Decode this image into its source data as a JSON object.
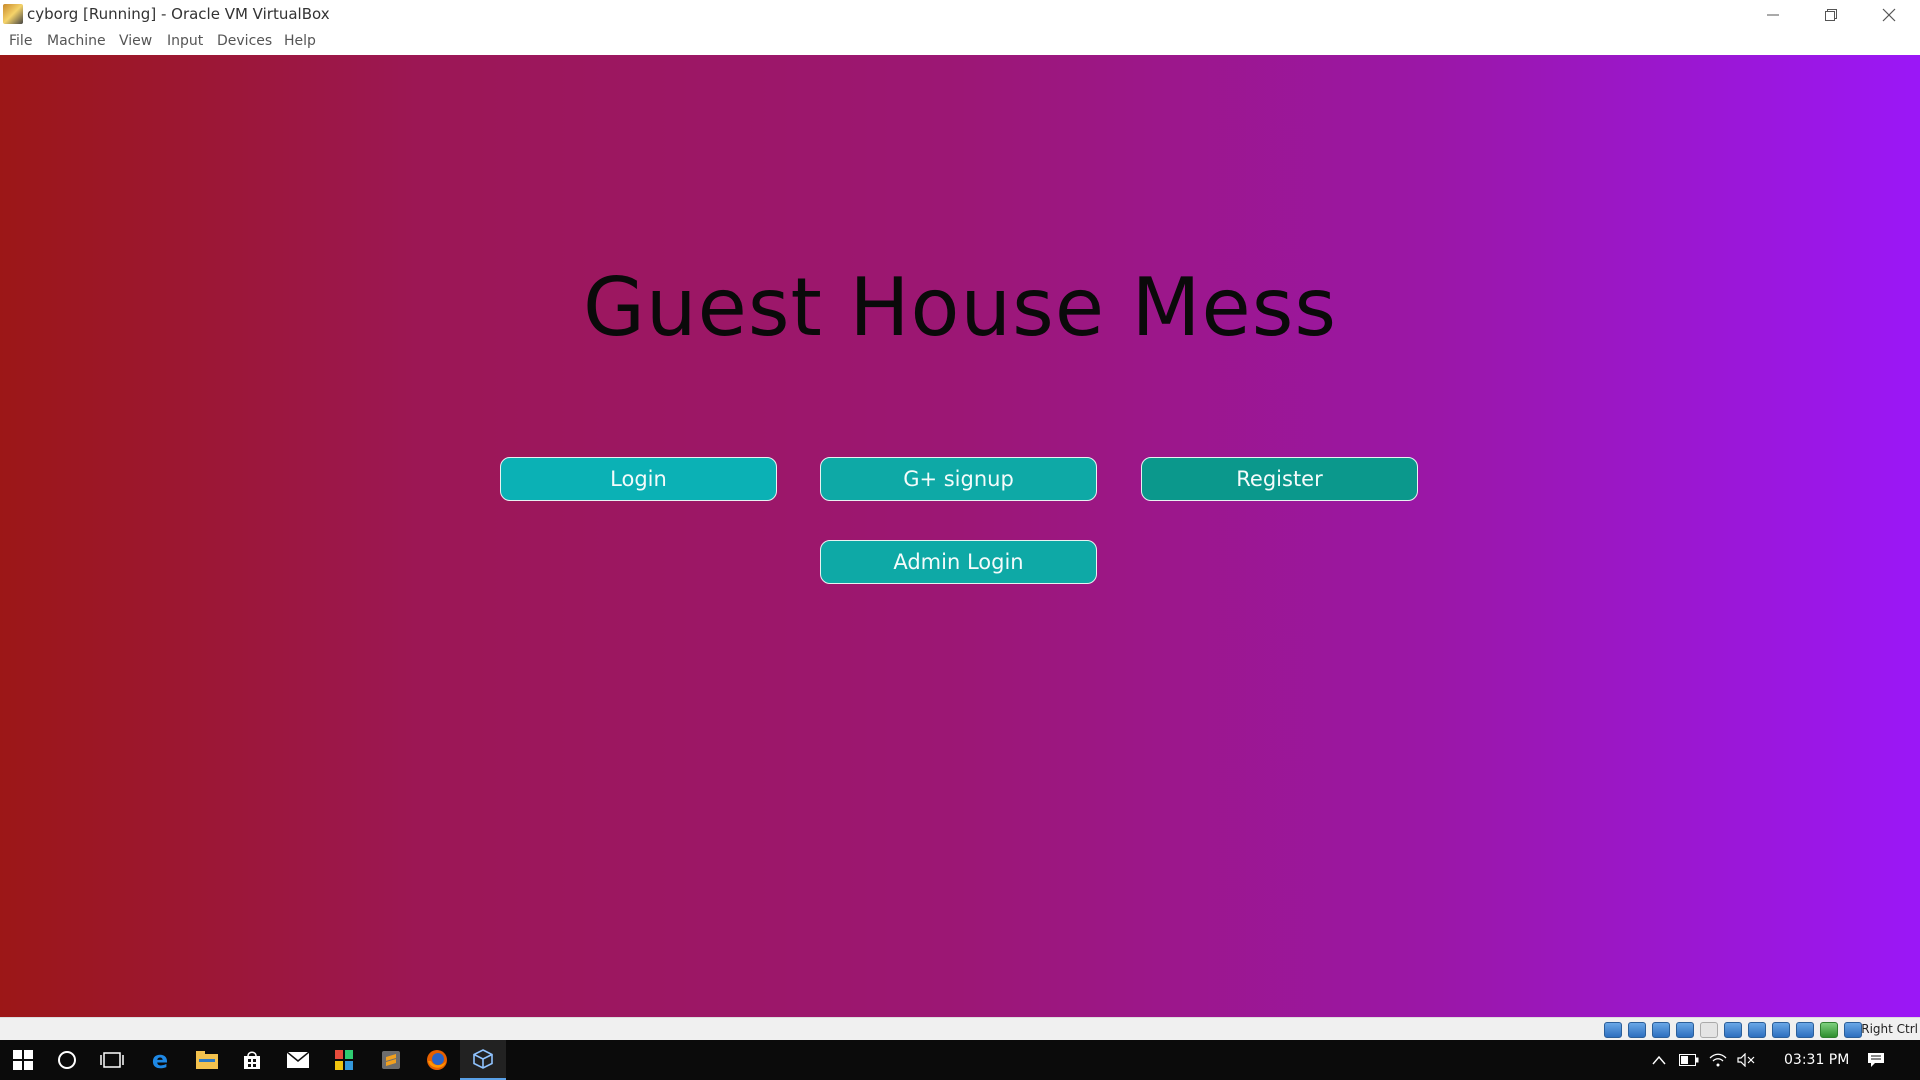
{
  "window": {
    "title": "cyborg [Running] - Oracle VM VirtualBox"
  },
  "menubar": {
    "items": [
      "File",
      "Machine",
      "View",
      "Input",
      "Devices",
      "Help"
    ]
  },
  "guest": {
    "heading": "Guest House Mess",
    "buttons": {
      "login": "Login",
      "gplus_signup": "G+ signup",
      "register": "Register",
      "admin_login": "Admin Login"
    },
    "colors": {
      "gradient_left": "#9c1717",
      "gradient_right": "#9b17f7",
      "button_login": "#0bb1b5",
      "button_gplus": "#0ea9a6",
      "button_register": "#0b988c",
      "button_admin": "#0ea9a6"
    }
  },
  "statusbar": {
    "host_key": "Right Ctrl",
    "icons": [
      "hard-disk-icon",
      "optical-drive-icon",
      "audio-icon",
      "network-icon",
      "usb-icon",
      "shared-folders-icon",
      "display-icon",
      "video-capture-icon",
      "cpu-icon",
      "mouse-integration-icon",
      "keyboard-icon"
    ]
  },
  "taskbar": {
    "clock": "03:31 PM",
    "apps": [
      "start-icon",
      "cortana-icon",
      "task-view-icon",
      "edge-icon",
      "file-explorer-icon",
      "store-icon",
      "mail-icon",
      "office-icon",
      "sublime-icon",
      "firefox-icon",
      "virtualbox-icon"
    ]
  }
}
